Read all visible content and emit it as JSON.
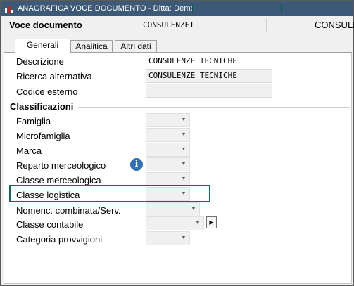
{
  "window": {
    "title": "ANAGRAFICA VOCE DOCUMENTO - Ditta: Demo"
  },
  "header": {
    "label": "Voce documento",
    "code_value": "CONSULENZET",
    "right_text": "CONSULE"
  },
  "tabs": [
    {
      "label": "Generali",
      "active": true
    },
    {
      "label": "Analitica",
      "active": false
    },
    {
      "label": "Altri dati",
      "active": false
    }
  ],
  "fields": {
    "descrizione": {
      "label": "Descrizione",
      "value": "CONSULENZE TECNICHE"
    },
    "ricerca_alternativa": {
      "label": "Ricerca alternativa",
      "value": "CONSULENZE TECNICHE"
    },
    "codice_esterno": {
      "label": "Codice esterno",
      "value": ""
    }
  },
  "classificazioni": {
    "section_title": "Classificazioni",
    "items": [
      {
        "label": "Famiglia",
        "value": ""
      },
      {
        "label": "Microfamiglia",
        "value": ""
      },
      {
        "label": "Marca",
        "value": ""
      },
      {
        "label": "Reparto merceologico",
        "value": ""
      },
      {
        "label": "Classe merceologica",
        "value": ""
      },
      {
        "label": "Classe logistica",
        "value": ""
      },
      {
        "label": "Nomenc. combinata/Serv.",
        "value": ""
      },
      {
        "label": "Classe contabile",
        "value": ""
      },
      {
        "label": "Categoria provvigioni",
        "value": ""
      }
    ]
  },
  "icons": {
    "app": "bar-chart-icon",
    "info": "info-icon",
    "dropdown": "chevron-down-icon",
    "nav": "play-arrow-icon"
  },
  "colors": {
    "titlebar": "#3c5a78",
    "highlight": "#0f6b5b",
    "info_icon": "#2f6fb5"
  }
}
